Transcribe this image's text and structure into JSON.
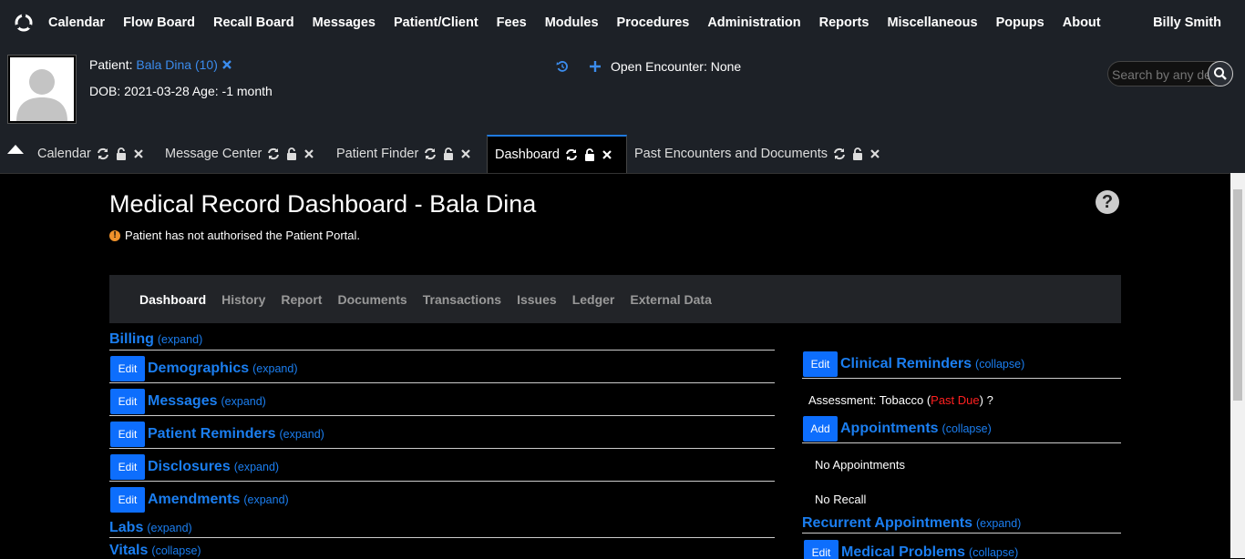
{
  "nav": {
    "items": [
      "Calendar",
      "Flow Board",
      "Recall Board",
      "Messages",
      "Patient/Client",
      "Fees",
      "Modules",
      "Procedures",
      "Administration",
      "Reports",
      "Miscellaneous",
      "Popups",
      "About"
    ],
    "user": "Billy Smith"
  },
  "patient": {
    "label": "Patient: ",
    "name": "Bala Dina (10)",
    "dob_line": "DOB: 2021-03-28 Age: -1 month",
    "encounter": "Open Encounter: None",
    "search_placeholder": "Search by any demographics"
  },
  "tabs": [
    {
      "label": "Calendar"
    },
    {
      "label": "Message Center"
    },
    {
      "label": "Patient Finder"
    },
    {
      "label": "Dashboard",
      "active": true
    },
    {
      "label": "Past Encounters and Documents"
    }
  ],
  "dashboard": {
    "title": "Medical Record Dashboard - Bala Dina",
    "help": "?",
    "warning": "Patient has not authorised the Patient Portal.",
    "subnav": [
      "Dashboard",
      "History",
      "Report",
      "Documents",
      "Transactions",
      "Issues",
      "Ledger",
      "External Data"
    ],
    "left_sections": [
      {
        "name": "Billing",
        "toggle": "(expand)"
      },
      {
        "name": "Demographics",
        "toggle": "(expand)",
        "button": "Edit"
      },
      {
        "name": "Messages",
        "toggle": "(expand)",
        "button": "Edit"
      },
      {
        "name": "Patient Reminders",
        "toggle": "(expand)",
        "button": "Edit"
      },
      {
        "name": "Disclosures",
        "toggle": "(expand)",
        "button": "Edit"
      },
      {
        "name": "Amendments",
        "toggle": "(expand)",
        "button": "Edit"
      },
      {
        "name": "Labs",
        "toggle": "(expand)"
      },
      {
        "name": "Vitals",
        "toggle": "(collapse)"
      }
    ],
    "right_sections": [
      {
        "name": "Clinical Reminders",
        "toggle": "(collapse)",
        "button": "Edit"
      },
      {
        "name": "Appointments",
        "toggle": "(collapse)",
        "button": "Add"
      },
      {
        "name": "Recurrent Appointments",
        "toggle": "(expand)"
      },
      {
        "name": "Medical Problems",
        "toggle": "(collapse)",
        "button": "Edit"
      }
    ],
    "reminder": {
      "prefix": "Assessment: Tobacco  (",
      "status": "Past Due",
      "suffix": ") ?"
    },
    "no_appointments": "No Appointments",
    "no_recall": "No Recall"
  },
  "colors": {
    "accent": "#1b7ef0",
    "button": "#0d6efd",
    "past_due": "#ff2020",
    "warning": "#f0922b"
  }
}
